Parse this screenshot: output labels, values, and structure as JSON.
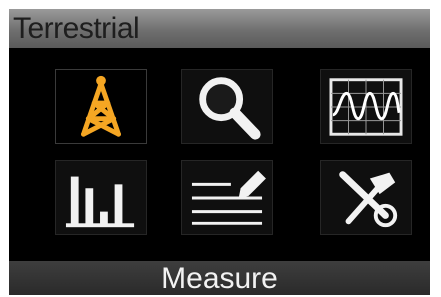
{
  "header": {
    "title": "Terrestrial"
  },
  "menu": {
    "selected_index": 0,
    "items": [
      {
        "icon": "antenna-tower-icon"
      },
      {
        "icon": "magnifier-icon"
      },
      {
        "icon": "waveform-monitor-icon"
      },
      {
        "icon": "bar-chart-icon"
      },
      {
        "icon": "notes-pencil-icon"
      },
      {
        "icon": "tools-icon"
      }
    ]
  },
  "footer": {
    "label": "Measure"
  },
  "colors": {
    "accent": "#f5a623",
    "title_bar": "#7a7a7a",
    "background": "#000000"
  }
}
